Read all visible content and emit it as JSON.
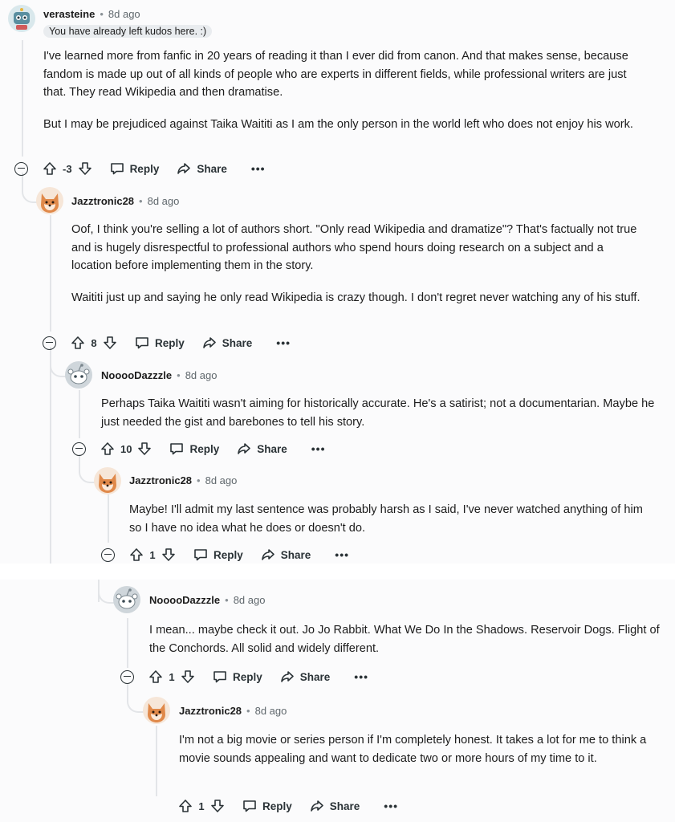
{
  "comments": [
    {
      "username": "verasteine",
      "age": "8d ago",
      "flair": "You have already left kudos here. :)",
      "paragraphs": [
        "I've learned more from fanfic in 20 years of reading it than I ever did from canon. And that makes sense, because fandom is made up out of all kinds of people who are experts in different fields, while professional writers are just that. They read Wikipedia and then dramatise.",
        "But I may be prejudiced against Taika Waititi as I am the only person in the world left who does not enjoy his work."
      ],
      "score": "-3"
    },
    {
      "username": "Jazztronic28",
      "age": "8d ago",
      "paragraphs": [
        "Oof, I think you're selling a lot of authors short. \"Only read Wikipedia and dramatize\"? That's factually not true and is hugely disrespectful to professional authors who spend hours doing research on a subject and a location before implementing them in the story.",
        "Waititi just up and saying he only read Wikipedia is crazy though. I don't regret never watching any of his stuff."
      ],
      "score": "8"
    },
    {
      "username": "NooooDazzzle",
      "age": "8d ago",
      "paragraphs": [
        "Perhaps Taika Waititi wasn't aiming for historically accurate. He's a satirist; not a documentarian. Maybe he just needed the gist and barebones to tell his story."
      ],
      "score": "10"
    },
    {
      "username": "Jazztronic28",
      "age": "8d ago",
      "paragraphs": [
        "Maybe! I'll admit my last sentence was probably harsh as I said, I've never watched anything of him so I have no idea what he does or doesn't do."
      ],
      "score": "1"
    },
    {
      "username": "NooooDazzzle",
      "age": "8d ago",
      "paragraphs": [
        "I mean... maybe check it out. Jo Jo Rabbit. What We Do In the Shadows. Reservoir Dogs. Flight of the Conchords. All solid and widely different."
      ],
      "score": "1"
    },
    {
      "username": "Jazztronic28",
      "age": "8d ago",
      "paragraphs": [
        "I'm not a big movie or series person if I'm completely honest. It takes a lot for me to think a movie sounds appealing and want to dedicate two or more hours of my time to it."
      ],
      "score": "1"
    }
  ],
  "labels": {
    "reply": "Reply",
    "share": "Share",
    "more": "•••",
    "separator": "•"
  },
  "icons": {
    "collapse": "collapse-icon",
    "upvote": "upvote-arrow-icon",
    "downvote": "downvote-arrow-icon",
    "reply": "speech-bubble-icon",
    "share": "share-arrow-icon",
    "more": "overflow-dots-icon"
  },
  "colors": {
    "background": "#fbfbfc",
    "thread_line": "#e3e5e8",
    "text": "#1c1c1c",
    "muted": "#60686d",
    "flair_bg": "#e9ecef"
  }
}
